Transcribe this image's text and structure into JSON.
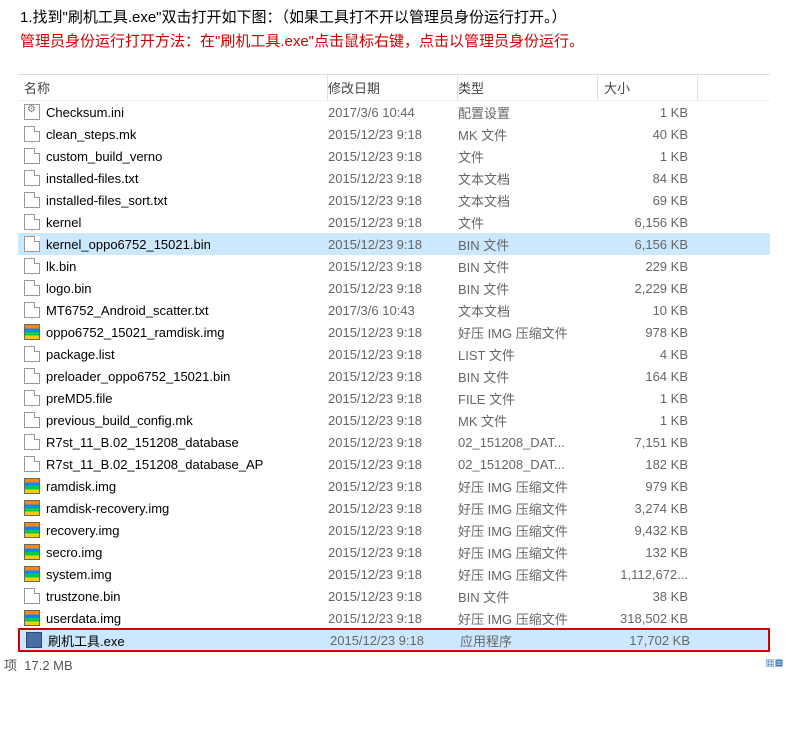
{
  "doc": {
    "line1": "1.找到\"刷机工具.exe\"双击打开如下图：（如果工具打不开以管理员身份运行打开。）",
    "line2": "管理员身份运行打开方法：在\"刷机工具.exe\"点击鼠标右键，点击以管理员身份运行。"
  },
  "headers": {
    "name": "名称",
    "date": "修改日期",
    "type": "类型",
    "size": "大小"
  },
  "files": [
    {
      "icon": "ini",
      "name": "Checksum.ini",
      "date": "2017/3/6 10:44",
      "type": "配置设置",
      "size": "1 KB",
      "sel": false
    },
    {
      "icon": "file",
      "name": "clean_steps.mk",
      "date": "2015/12/23 9:18",
      "type": "MK 文件",
      "size": "40 KB",
      "sel": false
    },
    {
      "icon": "file",
      "name": "custom_build_verno",
      "date": "2015/12/23 9:18",
      "type": "文件",
      "size": "1 KB",
      "sel": false
    },
    {
      "icon": "file",
      "name": "installed-files.txt",
      "date": "2015/12/23 9:18",
      "type": "文本文档",
      "size": "84 KB",
      "sel": false
    },
    {
      "icon": "file",
      "name": "installed-files_sort.txt",
      "date": "2015/12/23 9:18",
      "type": "文本文档",
      "size": "69 KB",
      "sel": false
    },
    {
      "icon": "file",
      "name": "kernel",
      "date": "2015/12/23 9:18",
      "type": "文件",
      "size": "6,156 KB",
      "sel": false
    },
    {
      "icon": "file",
      "name": "kernel_oppo6752_15021.bin",
      "date": "2015/12/23 9:18",
      "type": "BIN 文件",
      "size": "6,156 KB",
      "sel": true
    },
    {
      "icon": "file",
      "name": "lk.bin",
      "date": "2015/12/23 9:18",
      "type": "BIN 文件",
      "size": "229 KB",
      "sel": false
    },
    {
      "icon": "file",
      "name": "logo.bin",
      "date": "2015/12/23 9:18",
      "type": "BIN 文件",
      "size": "2,229 KB",
      "sel": false
    },
    {
      "icon": "file",
      "name": "MT6752_Android_scatter.txt",
      "date": "2017/3/6 10:43",
      "type": "文本文档",
      "size": "10 KB",
      "sel": false
    },
    {
      "icon": "img",
      "name": "oppo6752_15021_ramdisk.img",
      "date": "2015/12/23 9:18",
      "type": "好压 IMG 压缩文件",
      "size": "978 KB",
      "sel": false
    },
    {
      "icon": "file",
      "name": "package.list",
      "date": "2015/12/23 9:18",
      "type": "LIST 文件",
      "size": "4 KB",
      "sel": false
    },
    {
      "icon": "file",
      "name": "preloader_oppo6752_15021.bin",
      "date": "2015/12/23 9:18",
      "type": "BIN 文件",
      "size": "164 KB",
      "sel": false
    },
    {
      "icon": "file",
      "name": "preMD5.file",
      "date": "2015/12/23 9:18",
      "type": "FILE 文件",
      "size": "1 KB",
      "sel": false
    },
    {
      "icon": "file",
      "name": "previous_build_config.mk",
      "date": "2015/12/23 9:18",
      "type": "MK 文件",
      "size": "1 KB",
      "sel": false
    },
    {
      "icon": "file",
      "name": "R7st_11_B.02_151208_database",
      "date": "2015/12/23 9:18",
      "type": "02_151208_DAT...",
      "size": "7,151 KB",
      "sel": false
    },
    {
      "icon": "file",
      "name": "R7st_11_B.02_151208_database_AP",
      "date": "2015/12/23 9:18",
      "type": "02_151208_DAT...",
      "size": "182 KB",
      "sel": false
    },
    {
      "icon": "img",
      "name": "ramdisk.img",
      "date": "2015/12/23 9:18",
      "type": "好压 IMG 压缩文件",
      "size": "979 KB",
      "sel": false
    },
    {
      "icon": "img",
      "name": "ramdisk-recovery.img",
      "date": "2015/12/23 9:18",
      "type": "好压 IMG 压缩文件",
      "size": "3,274 KB",
      "sel": false
    },
    {
      "icon": "img",
      "name": "recovery.img",
      "date": "2015/12/23 9:18",
      "type": "好压 IMG 压缩文件",
      "size": "9,432 KB",
      "sel": false
    },
    {
      "icon": "img",
      "name": "secro.img",
      "date": "2015/12/23 9:18",
      "type": "好压 IMG 压缩文件",
      "size": "132 KB",
      "sel": false
    },
    {
      "icon": "img",
      "name": "system.img",
      "date": "2015/12/23 9:18",
      "type": "好压 IMG 压缩文件",
      "size": "1,112,672...",
      "sel": false
    },
    {
      "icon": "file",
      "name": "trustzone.bin",
      "date": "2015/12/23 9:18",
      "type": "BIN 文件",
      "size": "38 KB",
      "sel": false
    },
    {
      "icon": "img",
      "name": "userdata.img",
      "date": "2015/12/23 9:18",
      "type": "好压 IMG 压缩文件",
      "size": "318,502 KB",
      "sel": false
    },
    {
      "icon": "exe",
      "name": "刷机工具.exe",
      "date": "2015/12/23 9:18",
      "type": "应用程序",
      "size": "17,702 KB",
      "sel": true,
      "highlight": true
    }
  ],
  "status": {
    "left_count": "项",
    "left_size": "17.2 MB"
  }
}
